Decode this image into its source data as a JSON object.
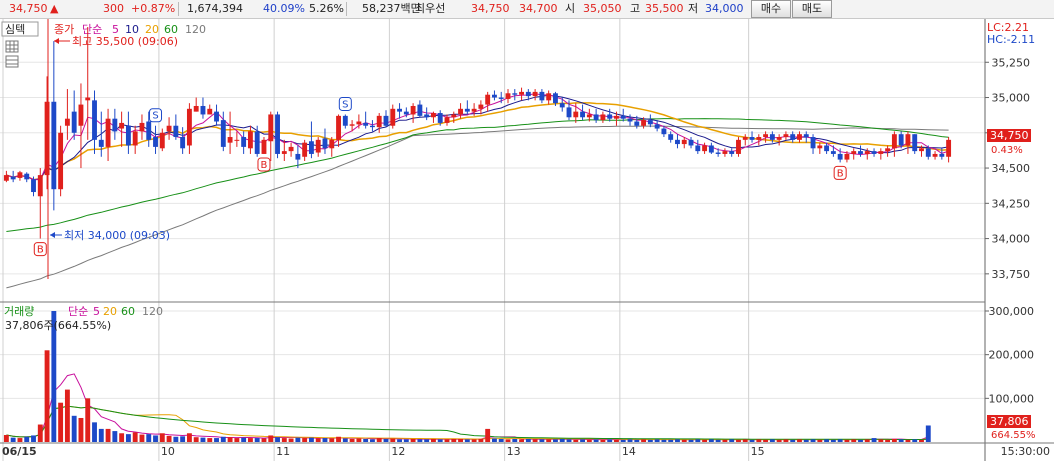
{
  "quote": {
    "price": "34,750",
    "arrow": "▲",
    "change": "300",
    "change_pct": "+0.87%",
    "volume": "1,674,394",
    "ratio1": "40.09%",
    "ratio2": "5.26%",
    "amount": "58,237백만",
    "bid_label": "최우선",
    "ask": "34,750",
    "bid": "34,700",
    "open_label": "시",
    "open": "35,050",
    "high_label": "고",
    "high": "35,500",
    "low_label": "저",
    "low": "34,000"
  },
  "buttons": {
    "buy": "매수",
    "sell": "매도"
  },
  "price_panel": {
    "tab_label": "심텍",
    "legend_title": "종가",
    "legend_avg": "단순",
    "ma_periods": [
      "5",
      "10",
      "20",
      "60",
      "120"
    ],
    "max_annotation": "최고 35,500 (09:06)",
    "min_annotation": "최저 34,000 (09:03)",
    "lc": "LC:2.21",
    "hc": "HC:-2.11",
    "current_label": "34,750",
    "current_pct": "0.43%"
  },
  "volume_panel": {
    "legend_title": "거래량",
    "legend_avg": "단순",
    "ma_periods": [
      "5",
      "20",
      "60",
      "120"
    ],
    "last_volume": "37,806주(664.55%)",
    "current_label": "37,806",
    "current_pct": "664.55%"
  },
  "colors": {
    "up": "#e0201c",
    "down": "#1d49c8",
    "ma5": "#c8109c",
    "ma10": "#1a1a8c",
    "ma20": "#e8a000",
    "ma60": "#179017",
    "ma120": "#7a7a7a"
  },
  "chart_data": {
    "type": "candlestick",
    "price_axis": {
      "ticks": [
        "35,250",
        "35,000",
        "34,750",
        "34,500",
        "34,250",
        "34,000",
        "33,750"
      ],
      "range": [
        33600,
        35500
      ]
    },
    "volume_axis": {
      "ticks": [
        "300,000",
        "200,000",
        "100,000"
      ],
      "range": [
        0,
        300000
      ]
    },
    "x_labels": [
      "06/15",
      "10",
      "11",
      "12",
      "13",
      "14",
      "15",
      "15:30:00"
    ],
    "candles": [
      [
        34410,
        34480,
        34400,
        34450
      ],
      [
        34440,
        34480,
        34400,
        34420
      ],
      [
        34430,
        34480,
        34410,
        34470
      ],
      [
        34460,
        34470,
        34400,
        34420
      ],
      [
        34420,
        34440,
        34300,
        34330
      ],
      [
        34300,
        34500,
        34000,
        34450
      ],
      [
        34450,
        35150,
        34350,
        34970
      ],
      [
        34970,
        35400,
        34200,
        34350
      ],
      [
        34350,
        34800,
        34300,
        34750
      ],
      [
        34800,
        35060,
        34700,
        34850
      ],
      [
        34900,
        35050,
        34700,
        34750
      ],
      [
        34800,
        35100,
        34500,
        34950
      ],
      [
        34980,
        35500,
        34700,
        35000
      ],
      [
        34980,
        35050,
        34600,
        34700
      ],
      [
        34700,
        34900,
        34580,
        34650
      ],
      [
        34650,
        34920,
        34550,
        34850
      ],
      [
        34850,
        34920,
        34700,
        34760
      ],
      [
        34780,
        34900,
        34650,
        34820
      ],
      [
        34800,
        34900,
        34600,
        34660
      ],
      [
        34660,
        34800,
        34600,
        34760
      ],
      [
        34760,
        34880,
        34700,
        34820
      ],
      [
        34830,
        34900,
        34650,
        34700
      ],
      [
        34720,
        34800,
        34600,
        34650
      ],
      [
        34640,
        34780,
        34620,
        34750
      ],
      [
        34760,
        34860,
        34700,
        34800
      ],
      [
        34800,
        34880,
        34700,
        34720
      ],
      [
        34720,
        34790,
        34600,
        34640
      ],
      [
        34660,
        34960,
        34600,
        34920
      ],
      [
        34900,
        35000,
        34900,
        34940
      ],
      [
        34940,
        35000,
        34850,
        34880
      ],
      [
        34880,
        34950,
        34880,
        34920
      ],
      [
        34900,
        34950,
        34800,
        34830
      ],
      [
        34840,
        34900,
        34620,
        34650
      ],
      [
        34680,
        34900,
        34600,
        34720
      ],
      [
        34700,
        34760,
        34650,
        34700
      ],
      [
        34720,
        34760,
        34600,
        34650
      ],
      [
        34640,
        34800,
        34600,
        34760
      ],
      [
        34760,
        34800,
        34580,
        34600
      ],
      [
        34600,
        34720,
        34600,
        34700
      ],
      [
        34690,
        34900,
        34550,
        34880
      ],
      [
        34880,
        34900,
        34570,
        34600
      ],
      [
        34600,
        34700,
        34550,
        34620
      ],
      [
        34620,
        34680,
        34580,
        34650
      ],
      [
        34600,
        34660,
        34500,
        34560
      ],
      [
        34580,
        34700,
        34550,
        34680
      ],
      [
        34690,
        34830,
        34570,
        34600
      ],
      [
        34610,
        34720,
        34580,
        34700
      ],
      [
        34710,
        34780,
        34600,
        34640
      ],
      [
        34640,
        34720,
        34580,
        34700
      ],
      [
        34700,
        34880,
        34650,
        34870
      ],
      [
        34870,
        34880,
        34780,
        34800
      ],
      [
        34800,
        34840,
        34760,
        34810
      ],
      [
        34810,
        34880,
        34780,
        34830
      ],
      [
        34820,
        34900,
        34780,
        34800
      ],
      [
        34800,
        34840,
        34760,
        34790
      ],
      [
        34790,
        34890,
        34750,
        34870
      ],
      [
        34870,
        34910,
        34790,
        34800
      ],
      [
        34800,
        34950,
        34780,
        34920
      ],
      [
        34920,
        34960,
        34850,
        34900
      ],
      [
        34900,
        34930,
        34860,
        34880
      ],
      [
        34880,
        34960,
        34820,
        34940
      ],
      [
        34950,
        34980,
        34860,
        34870
      ],
      [
        34880,
        34930,
        34840,
        34860
      ],
      [
        34860,
        34900,
        34820,
        34890
      ],
      [
        34890,
        34910,
        34800,
        34820
      ],
      [
        34820,
        34880,
        34800,
        34860
      ],
      [
        34860,
        34900,
        34820,
        34880
      ],
      [
        34880,
        34960,
        34850,
        34920
      ],
      [
        34920,
        34980,
        34880,
        34900
      ],
      [
        34900,
        34960,
        34870,
        34920
      ],
      [
        34920,
        34980,
        34880,
        34950
      ],
      [
        34950,
        35040,
        34900,
        35020
      ],
      [
        35020,
        35050,
        34980,
        35000
      ],
      [
        35000,
        35040,
        34960,
        34990
      ],
      [
        34990,
        35060,
        34960,
        35030
      ],
      [
        35030,
        35060,
        34980,
        35020
      ],
      [
        35020,
        35070,
        34980,
        35040
      ],
      [
        35040,
        35060,
        34980,
        35010
      ],
      [
        35010,
        35060,
        34980,
        35040
      ],
      [
        35040,
        35060,
        34960,
        34980
      ],
      [
        34980,
        35050,
        34950,
        35030
      ],
      [
        35030,
        35040,
        34940,
        34960
      ],
      [
        34960,
        35000,
        34900,
        34930
      ],
      [
        34930,
        34980,
        34840,
        34860
      ],
      [
        34860,
        34960,
        34820,
        34900
      ],
      [
        34900,
        34950,
        34840,
        34860
      ],
      [
        34860,
        34920,
        34830,
        34880
      ],
      [
        34880,
        34920,
        34820,
        34840
      ],
      [
        34840,
        34900,
        34820,
        34880
      ],
      [
        34880,
        34920,
        34830,
        34850
      ],
      [
        34850,
        34900,
        34800,
        34870
      ],
      [
        34870,
        34920,
        34830,
        34850
      ],
      [
        34850,
        34880,
        34800,
        34830
      ],
      [
        34830,
        34870,
        34780,
        34800
      ],
      [
        34800,
        34860,
        34780,
        34840
      ],
      [
        34840,
        34880,
        34790,
        34810
      ],
      [
        34810,
        34840,
        34760,
        34780
      ],
      [
        34780,
        34800,
        34720,
        34740
      ],
      [
        34740,
        34760,
        34680,
        34700
      ],
      [
        34700,
        34740,
        34640,
        34670
      ],
      [
        34670,
        34720,
        34640,
        34700
      ],
      [
        34700,
        34720,
        34640,
        34660
      ],
      [
        34660,
        34700,
        34600,
        34620
      ],
      [
        34620,
        34680,
        34600,
        34660
      ],
      [
        34660,
        34680,
        34600,
        34610
      ],
      [
        34610,
        34640,
        34580,
        34600
      ],
      [
        34600,
        34640,
        34580,
        34620
      ],
      [
        34620,
        34640,
        34580,
        34600
      ],
      [
        34600,
        34720,
        34580,
        34700
      ],
      [
        34700,
        34740,
        34660,
        34720
      ],
      [
        34720,
        34760,
        34680,
        34700
      ],
      [
        34700,
        34740,
        34660,
        34720
      ],
      [
        34720,
        34760,
        34680,
        34740
      ],
      [
        34740,
        34760,
        34680,
        34700
      ],
      [
        34700,
        34740,
        34660,
        34720
      ],
      [
        34720,
        34760,
        34700,
        34740
      ],
      [
        34740,
        34760,
        34680,
        34700
      ],
      [
        34700,
        34760,
        34680,
        34740
      ],
      [
        34740,
        34760,
        34680,
        34720
      ],
      [
        34720,
        34740,
        34600,
        34640
      ],
      [
        34640,
        34680,
        34600,
        34660
      ],
      [
        34660,
        34680,
        34600,
        34620
      ],
      [
        34620,
        34660,
        34580,
        34600
      ],
      [
        34600,
        34640,
        34540,
        34560
      ],
      [
        34560,
        34620,
        34540,
        34600
      ],
      [
        34600,
        34640,
        34560,
        34620
      ],
      [
        34620,
        34660,
        34580,
        34600
      ],
      [
        34600,
        34640,
        34560,
        34620
      ],
      [
        34620,
        34640,
        34580,
        34600
      ],
      [
        34600,
        34640,
        34560,
        34620
      ],
      [
        34620,
        34660,
        34580,
        34640
      ],
      [
        34640,
        34760,
        34580,
        34740
      ],
      [
        34740,
        34760,
        34640,
        34660
      ],
      [
        34660,
        34760,
        34600,
        34740
      ],
      [
        34740,
        34740,
        34600,
        34620
      ],
      [
        34620,
        34660,
        34580,
        34640
      ],
      [
        34640,
        34660,
        34560,
        34580
      ],
      [
        34580,
        34620,
        34560,
        34600
      ],
      [
        34600,
        34640,
        34560,
        34580
      ],
      [
        34580,
        34720,
        34540,
        34700
      ]
    ],
    "volumes": [
      16000,
      10000,
      9000,
      12000,
      15000,
      40000,
      210000,
      300000,
      90000,
      120000,
      60000,
      55000,
      100000,
      45000,
      30000,
      30000,
      25000,
      20000,
      18000,
      22000,
      17000,
      18000,
      15000,
      20000,
      14000,
      12000,
      13000,
      20000,
      11000,
      10000,
      9000,
      9000,
      12000,
      11000,
      9000,
      10000,
      9000,
      9000,
      8000,
      15000,
      11000,
      9000,
      8000,
      10000,
      9000,
      10000,
      8000,
      9000,
      8000,
      12000,
      8000,
      7000,
      8000,
      7000,
      6000,
      9000,
      7000,
      8000,
      6000,
      6000,
      7000,
      6000,
      6000,
      7000,
      6000,
      6000,
      7000,
      7000,
      6000,
      6000,
      7000,
      30000,
      8000,
      7000,
      6000,
      7000,
      6000,
      7000,
      6000,
      6000,
      6000,
      6000,
      7000,
      6000,
      5000,
      6000,
      5000,
      6000,
      5000,
      6000,
      5000,
      5000,
      6000,
      5000,
      6000,
      5000,
      6000,
      5000,
      5000,
      6000,
      5000,
      5000,
      6000,
      5000,
      6000,
      5000,
      5000,
      6000,
      5000,
      6000,
      5000,
      6000,
      5000,
      6000,
      5000,
      6000,
      5000,
      6000,
      5000,
      6000,
      5000,
      6000,
      5000,
      6000,
      5000,
      6000,
      5000,
      6000,
      9000,
      6000,
      5000,
      7000,
      6000,
      5000,
      6000,
      5000,
      37806
    ],
    "markers": [
      {
        "type": "B",
        "index": 5
      },
      {
        "type": "S",
        "index": 22
      },
      {
        "type": "B",
        "index": 38
      },
      {
        "type": "S",
        "index": 50
      },
      {
        "type": "B",
        "index": 123
      }
    ]
  }
}
